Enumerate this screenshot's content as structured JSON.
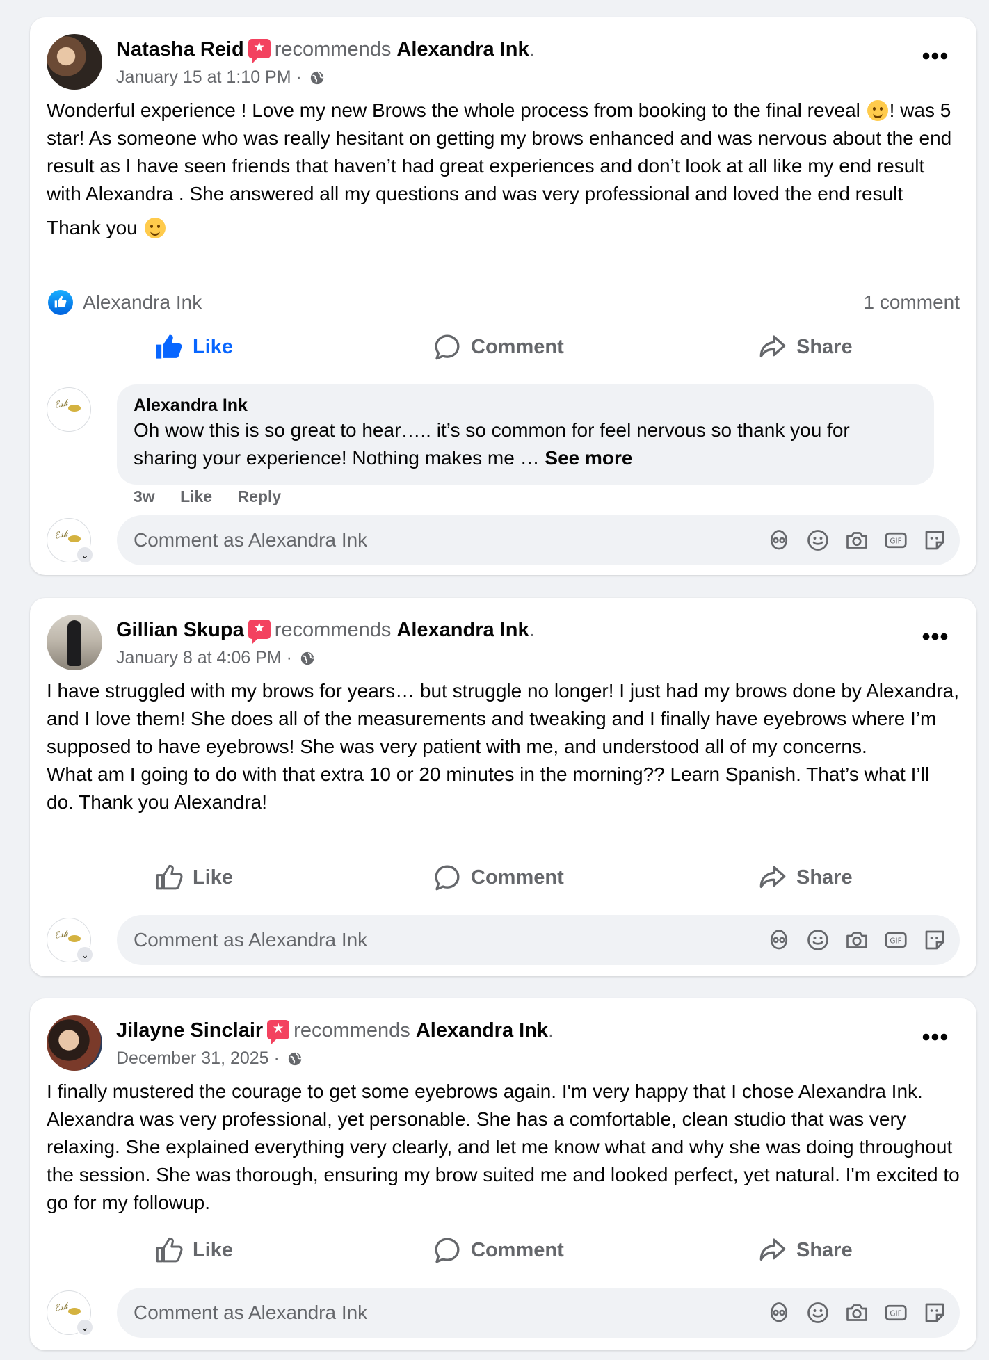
{
  "reviews": [
    {
      "author": "Natasha Reid",
      "recommends_word": "recommends",
      "page": "Alexandra Ink",
      "date": "January 15 at 1:10 PM",
      "text_part1": "Wonderful experience ! Love my new Brows the whole process from booking to the final reveal ",
      "text_part2": "! was 5 star! As someone who was really hesitant on getting my brows enhanced and was nervous  about the end result as I have seen friends that haven’t had great experiences and don’t look at all like my end result with Alexandra .  She answered all my questions and was very professional and loved the end result",
      "text_thanks": "Thank you ",
      "reactor": "Alexandra Ink",
      "comment_count": "1 comment",
      "comment": {
        "author": "Alexandra Ink",
        "text": "Oh wow this is so great to hear….. it’s so common for feel nervous so thank you for sharing your experience! Nothing makes me … ",
        "see_more": "See more",
        "time": "3w",
        "like": "Like",
        "reply": "Reply"
      }
    },
    {
      "author": "Gillian Skupa",
      "recommends_word": "recommends",
      "page": "Alexandra Ink",
      "date": "January 8 at 4:06 PM",
      "text_part1": "I have struggled with my brows for years… but struggle no longer! I just had my brows done by Alexandra, and I love them! She does all of the measurements and tweaking and I finally have eyebrows where I’m supposed to have eyebrows! She was very patient with me, and understood all of my concerns.",
      "text_part2": "What am I going to do with that extra 10 or 20 minutes in the morning?? Learn Spanish. That’s what I’ll do. Thank you Alexandra!"
    },
    {
      "author": "Jilayne Sinclair",
      "recommends_word": "recommends",
      "page": "Alexandra Ink",
      "date": "December 31, 2025",
      "text_part1": "I finally mustered the courage to get some eyebrows again. I'm very happy that I chose Alexandra Ink. Alexandra was very professional, yet personable. She has a comfortable, clean studio that was very relaxing. She explained everything very clearly, and let me know what and why she was doing throughout the session. She was thorough, ensuring my brow suited me and looked perfect, yet natural. I'm excited to go for my followup."
    }
  ],
  "actions": {
    "like": "Like",
    "comment": "Comment",
    "share": "Share"
  },
  "compose": {
    "placeholder": "Comment as Alexandra Ink"
  },
  "colors": {
    "background": "#f0f2f5",
    "card": "#ffffff",
    "secondary_text": "#65676b",
    "like_blue": "#0866ff",
    "recommend_badge": "#f3425f"
  }
}
